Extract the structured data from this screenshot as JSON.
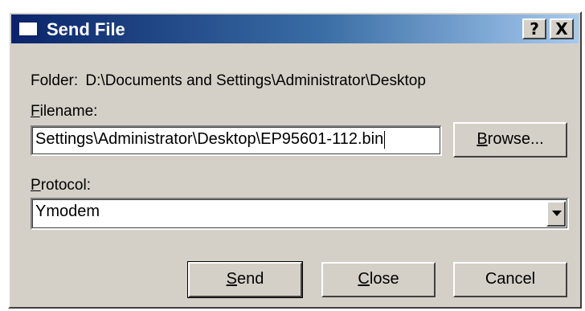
{
  "window": {
    "title": "Send File",
    "help_label": "?",
    "close_label": "X"
  },
  "folder": {
    "label": "Folder:",
    "path": "D:\\Documents and Settings\\Administrator\\Desktop"
  },
  "filename": {
    "label_first": "F",
    "label_rest": "ilename:",
    "value": "Settings\\Administrator\\Desktop\\EP95601-112.bin"
  },
  "browse": {
    "label_first": "B",
    "label_rest": "rowse..."
  },
  "protocol": {
    "label_first": "P",
    "label_rest": "rotocol:",
    "selected": "Ymodem"
  },
  "buttons": {
    "send_first": "S",
    "send_rest": "end",
    "close_first": "C",
    "close_rest": "lose",
    "cancel": "Cancel"
  }
}
